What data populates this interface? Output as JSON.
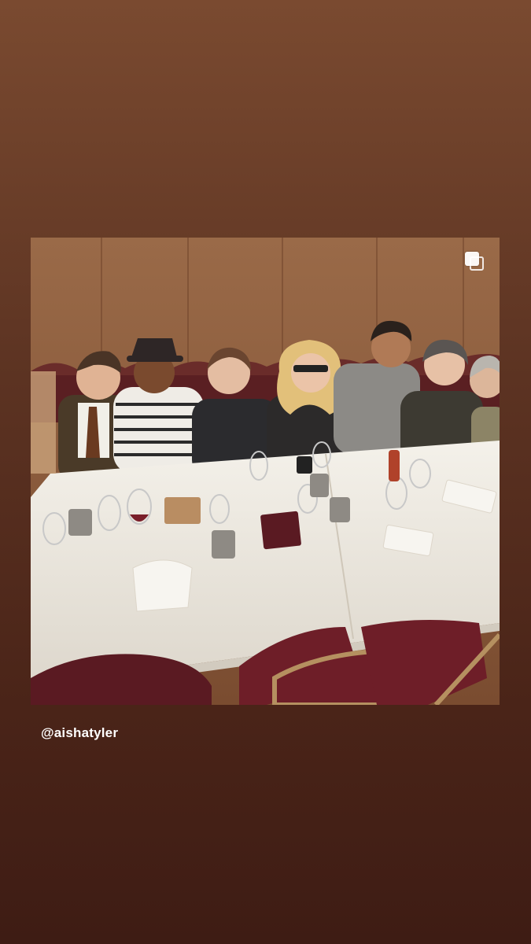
{
  "story": {
    "mention": "@aishatyler",
    "photo": {
      "multi_photo_icon": "carousel-icon"
    }
  }
}
